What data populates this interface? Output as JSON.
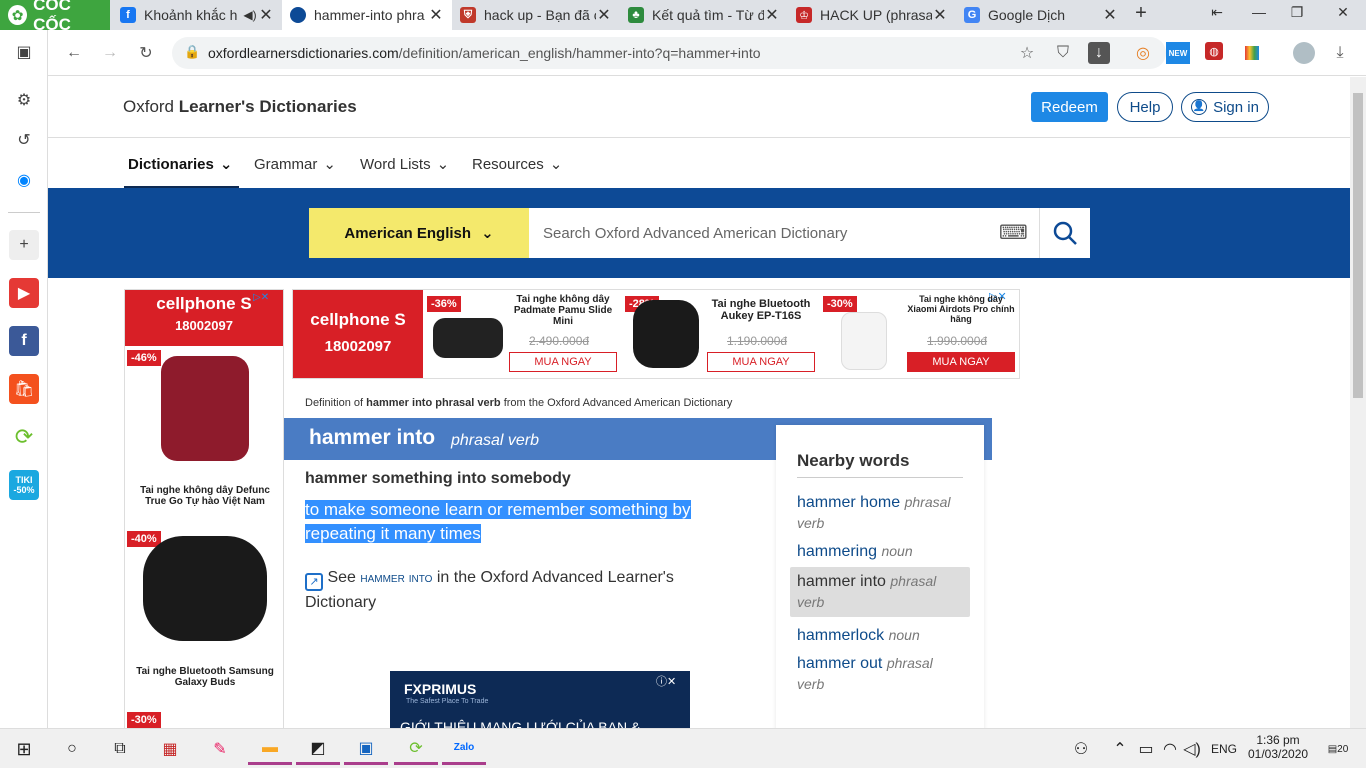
{
  "browser": {
    "brand_label": "CỐC CỐC",
    "tabs": [
      {
        "title": "Khoảnh khắc h",
        "icon": "facebook-icon",
        "color": "#1877f2"
      },
      {
        "title": "hammer-into phra",
        "icon": "oxford-icon",
        "color": "#0d4a96"
      },
      {
        "title": "hack up - Bạn đã c",
        "icon": "shield-icon",
        "color": "#c0392b"
      },
      {
        "title": "Kết quả tìm - Từ đ",
        "icon": "leaf-icon",
        "color": "#2e8b3e"
      },
      {
        "title": "HACK UP (phrasal",
        "icon": "cambridge-icon",
        "color": "#c62828"
      },
      {
        "title": "Google Dịch",
        "icon": "google-translate-icon",
        "color": "#4285f4"
      }
    ],
    "new_tab": "+",
    "url_host": "oxfordlearnersdictionaries.com",
    "url_path": "/definition/american_english/hammer-into?q=hammer+into",
    "new_badge": "NEW"
  },
  "site": {
    "brand_light": "Oxford ",
    "brand_bold": "Learner's Dictionaries",
    "redeem": "Redeem",
    "help": "Help",
    "sign_in": "Sign in",
    "nav": [
      "Dictionaries",
      "Grammar",
      "Word Lists",
      "Resources"
    ],
    "dict_select": "American English",
    "search_placeholder": "Search Oxford Advanced American Dictionary"
  },
  "ads": {
    "brand": "cellphone S",
    "phone": "18002097",
    "left": [
      {
        "discount": "-46%",
        "name": "Tai nghe không dây Defunc True Go Tự hào Việt Nam"
      },
      {
        "discount": "-40%",
        "name": "Tai nghe Bluetooth Samsung Galaxy Buds"
      },
      {
        "discount": "-30%",
        "name": ""
      }
    ],
    "top": [
      {
        "discount": "-36%",
        "name": "Tai nghe không dây Padmate Pamu Slide Mini",
        "price": "2.490.000đ",
        "cta": "MUA NGAY"
      },
      {
        "discount": "-28%",
        "name": "Tai nghe Bluetooth Aukey EP-T16S",
        "price": "1.190.000đ",
        "cta": "MUA NGAY"
      },
      {
        "discount": "-30%",
        "name": "Tai nghe không dây Xiaomi Airdots Pro chính hãng",
        "price": "1.990.000đ",
        "cta": "MUA NGAY"
      }
    ],
    "fx_brand": "FXPRIMUS",
    "fx_tagline": "The Safest Place To Trade",
    "fx_text": "GIỚI THIỆU MẠNG LƯỚI CỦA BẠN &"
  },
  "entry": {
    "breadcrumb_pre": "Definition of ",
    "breadcrumb_bold": "hammer into phrasal verb",
    "breadcrumb_post": " from the Oxford Advanced American Dictionary",
    "headword": "hammer into",
    "pos": "phrasal verb",
    "pattern": "hammer something into somebody",
    "definition": "to make someone learn or remember something by repeating it many times",
    "see_pre": "See ",
    "see_link": "hammer into",
    "see_post": " in the Oxford Advanced Learner's Dictionary"
  },
  "nearby": {
    "title": "Nearby words",
    "items": [
      {
        "word": "hammer home",
        "pos": "phrasal verb"
      },
      {
        "word": "hammering",
        "pos": "noun"
      },
      {
        "word": "hammer into",
        "pos": "phrasal verb",
        "current": true
      },
      {
        "word": "hammerlock",
        "pos": "noun"
      },
      {
        "word": "hammer out",
        "pos": "phrasal verb"
      }
    ]
  },
  "taskbar": {
    "lang": "ENG",
    "time": "1:36 pm",
    "date": "01/03/2020",
    "notifications": "20"
  }
}
